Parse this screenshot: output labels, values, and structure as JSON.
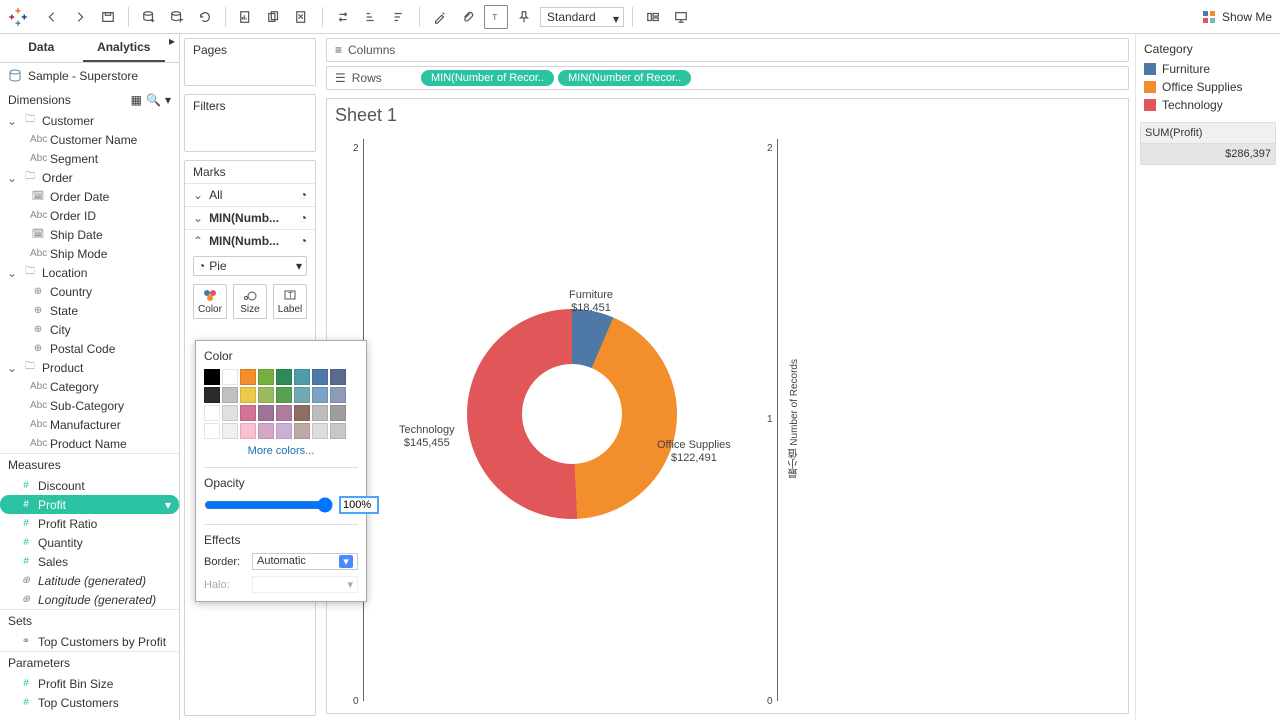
{
  "toolbar": {
    "fit_mode": "Standard",
    "show_me": "Show Me"
  },
  "side_tabs": {
    "data": "Data",
    "analytics": "Analytics"
  },
  "datasource": "Sample - Superstore",
  "dimensions_header": "Dimensions",
  "measures_header": "Measures",
  "sets_header": "Sets",
  "parameters_header": "Parameters",
  "dimensions": {
    "customer": {
      "label": "Customer",
      "fields": [
        "Customer Name",
        "Segment"
      ]
    },
    "order": {
      "label": "Order",
      "fields": [
        "Order Date",
        "Order ID",
        "Ship Date",
        "Ship Mode"
      ]
    },
    "location": {
      "label": "Location",
      "fields": [
        "Country",
        "State",
        "City",
        "Postal Code"
      ]
    },
    "product": {
      "label": "Product",
      "fields": [
        "Category",
        "Sub-Category",
        "Manufacturer",
        "Product Name"
      ]
    }
  },
  "measures": [
    "Discount",
    "Profit",
    "Profit Ratio",
    "Quantity",
    "Sales",
    "Latitude (generated)",
    "Longitude (generated)"
  ],
  "sets": [
    "Top Customers by Profit"
  ],
  "parameters": [
    "Profit Bin Size",
    "Top Customers"
  ],
  "cards": {
    "pages": "Pages",
    "filters": "Filters",
    "marks": "Marks"
  },
  "marks": {
    "all": "All",
    "mn1": "MIN(Numb...",
    "mn2": "MIN(Numb...",
    "chart_type": "Pie",
    "color": "Color",
    "size": "Size",
    "label": "Label"
  },
  "shelves": {
    "columns": "Columns",
    "rows": "Rows"
  },
  "row_pills": [
    "MIN(Number of Recor..",
    "MIN(Number of Recor.."
  ],
  "sheet_title": "Sheet 1",
  "axis_label": "最小值 Number of Records",
  "legend": {
    "title": "Category",
    "items": [
      {
        "label": "Furniture",
        "color": "#4e79a7"
      },
      {
        "label": "Office Supplies",
        "color": "#f28e2b"
      },
      {
        "label": "Technology",
        "color": "#e15759"
      }
    ],
    "sum_title": "SUM(Profit)",
    "sum_value": "$286,397"
  },
  "chart_labels": {
    "furniture": {
      "name": "Furniture",
      "val": "$18,451"
    },
    "office": {
      "name": "Office Supplies",
      "val": "$122,491"
    },
    "tech": {
      "name": "Technology",
      "val": "$145,455"
    }
  },
  "color_popup": {
    "title": "Color",
    "more": "More colors...",
    "opacity_label": "Opacity",
    "opacity_value": "100%",
    "effects_label": "Effects",
    "border_label": "Border:",
    "border_value": "Automatic",
    "halo_label": "Halo:"
  },
  "palette": [
    "#000000",
    "#ffffff",
    "#f28e2b",
    "#76b041",
    "#2e8b57",
    "#4e9caa",
    "#4e79a7",
    "#5a6b8c",
    "#2b2b2b",
    "#c0c0c0",
    "#edc948",
    "#9cbb5c",
    "#59a14f",
    "#6faab0",
    "#7aa3c9",
    "#8c9cb8",
    "#ffffff",
    "#e0e0e0",
    "#d37295",
    "#a0729a",
    "#b07aa1",
    "#8d6e63",
    "#bdbdbd",
    "#9e9e9e",
    "#ffffff",
    "#f0f0f0",
    "#fabfd2",
    "#d4a6c8",
    "#c9b1d6",
    "#bcaaa4",
    "#dddddd",
    "#c7c7c7"
  ],
  "chart_data": {
    "type": "pie",
    "title": "Sheet 1",
    "series": [
      {
        "name": "Furniture",
        "value": 18451,
        "color": "#4e79a7"
      },
      {
        "name": "Office Supplies",
        "value": 122491,
        "color": "#f28e2b"
      },
      {
        "name": "Technology",
        "value": 145455,
        "color": "#e15759"
      }
    ],
    "total": 286397,
    "inner_radius_pct": 48
  }
}
